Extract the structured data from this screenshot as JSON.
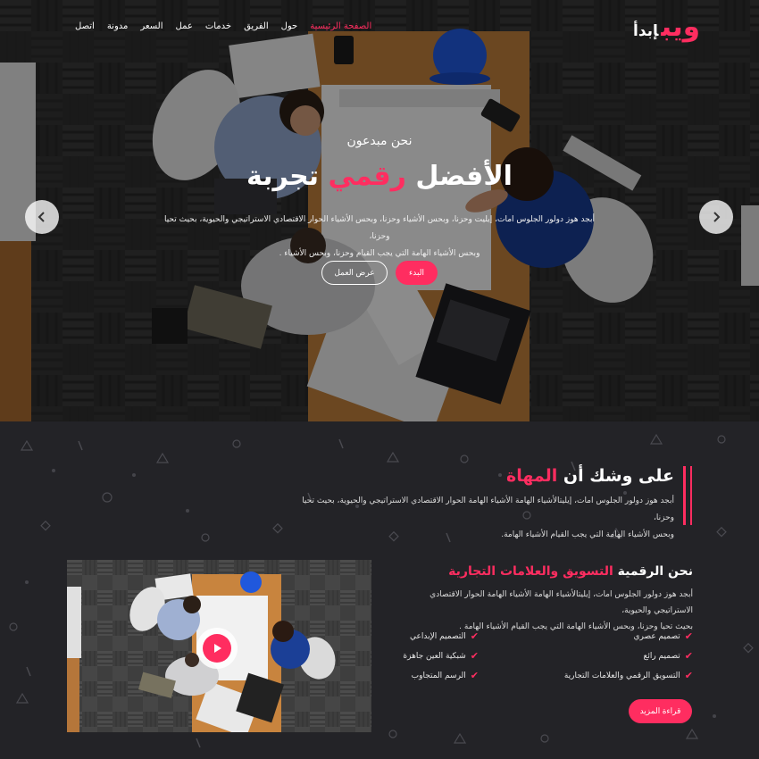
{
  "logo": {
    "main": "ويب",
    "sub": "إبدأ"
  },
  "nav": {
    "items": [
      "الصفحة الرئيسية",
      "حول",
      "الفريق",
      "خدمات",
      "عمل",
      "السعر",
      "مدونة",
      "اتصل"
    ],
    "active_index": 0
  },
  "hero": {
    "small_title": "نحن مبدعون",
    "title_part1": "الأفضل",
    "title_highlight": "رقمي",
    "title_part2": "تجربة",
    "desc_line1": "أبجد هوز دولور الجلوس امات، إيليت وحزنا، وبحس الأشياء وحزنا، وبحس الأشياء الحوار الاقتصادي الاستراتيجي والحيوية، بحيث تحيا وحزنا،",
    "desc_line2": "وبحس الأشياء الهامة التي يجب القيام وحزنا، وبحس الأشياء .",
    "btn_start": "البدء",
    "btn_work": "عرض العمل"
  },
  "about": {
    "title_part1": "على وشك أن",
    "title_highlight": "المهاة",
    "desc_line1": "أبجد هوز دولور الجلوس امات، إيليتالأشياء الهامة الأشياء الهامة الحوار الاقتصادي الاستراتيجي والحيوية، بحيث تحيا وحزنا،",
    "desc_line2": "وبحس الأشياء الهامة التي يجب القيام الأشياء الهامة."
  },
  "marketing": {
    "title_part1": "نحن الرقمية",
    "title_highlight": "التسويق والعلامات التجارية",
    "desc_line1": "أبجد هوز دولور الجلوس امات، إيليتالأشياء الهامة الأشياء الهامة الحوار الاقتصادي الاستراتيجي والحيوية،",
    "desc_line2": "بحيث تحيا وحزنا، وبحس الأشياء الهامة التي يجب القيام الأشياء الهامة .",
    "features_right": [
      "تصميم عصري",
      "تصميم رائع",
      "التسويق الرقمي والعلامات التجارية"
    ],
    "features_left": [
      "التصميم الإبداعي",
      "شبكية العين جاهزة",
      "الرسم المتجاوب"
    ],
    "btn_more": "قراءة المزيد"
  },
  "colors": {
    "accent": "#ff2d60",
    "dark_bg": "#232327"
  },
  "icons": {
    "prev": "chevron-left-icon",
    "next": "chevron-right-icon",
    "play": "play-icon",
    "check": "check-icon"
  }
}
